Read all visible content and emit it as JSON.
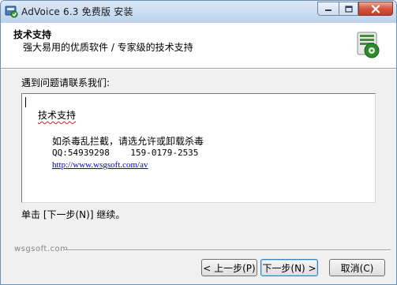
{
  "window": {
    "title": "AdVoice 6.3 免费版 安装"
  },
  "header": {
    "title": "技术支持",
    "subtitle": "强大易用的优质软件 / 专家级的技术支持"
  },
  "content": {
    "label": "遇到问题请联系我们:",
    "textbox": {
      "heading": "技术支持",
      "line1": "如杀毒乱拦截，请选允许或卸载杀毒",
      "line2": "QQ:54939298    159-0179-2535",
      "link": "http://www.wsgsoft.com/av"
    },
    "continue_text": "单击 [下一步(N)] 继续。"
  },
  "footer": {
    "brand": "wsgsoft.com",
    "buttons": {
      "back": "< 上一步(P)",
      "next": "下一步(N) >",
      "cancel": "取消(C)"
    }
  },
  "colors": {
    "title_bar": "#c9dcf0",
    "close_button": "#d3553e",
    "link": "#0000cc"
  },
  "icons": [
    "installer-icon",
    "minimize-icon",
    "maximize-icon",
    "close-icon",
    "package-install-icon"
  ]
}
